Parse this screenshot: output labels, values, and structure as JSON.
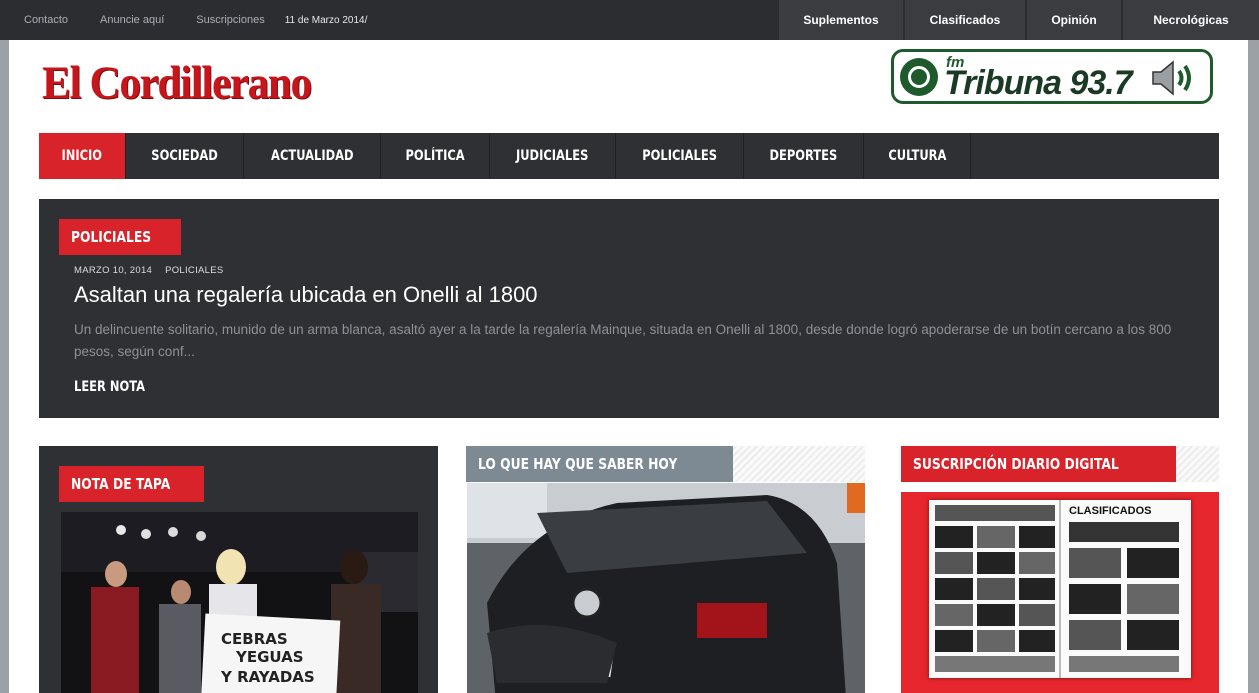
{
  "topbar": {
    "links": [
      "Contacto",
      "Anuncie aquí",
      "Suscripciones"
    ],
    "date": "11 de Marzo 2014/",
    "sections": [
      "Suplementos",
      "Clasificados",
      "Opinión",
      "Necrológicas"
    ]
  },
  "logo": "El Cordillerano",
  "radio": {
    "fm": "fm",
    "name": "Tribuna 93.7"
  },
  "nav": [
    "INICIO",
    "SOCIEDAD",
    "ACTUALIDAD",
    "POLÍTICA",
    "JUDICIALES",
    "POLICIALES",
    "DEPORTES",
    "CULTURA"
  ],
  "featured": {
    "tag": "POLICIALES",
    "date": "MARZO 10, 2014",
    "category": "POLICIALES",
    "headline": "Asaltan una regalería ubicada en Onelli al 1800",
    "excerpt": "Un delincuente solitario, munido de un arma blanca, asaltó ayer a la tarde la regalería Mainque, situada en Onelli al 1800, desde donde logró apoderarse de un botín cercano a los 800 pesos, según conf...",
    "read_more": "LEER NOTA"
  },
  "columns": {
    "nota_de_tapa": {
      "tag": "NOTA DE TAPA",
      "banner_lines": [
        "CEBRAS",
        "YEGUAS",
        "Y RAYADAS"
      ]
    },
    "saber_hoy": {
      "tag": "LO QUE HAY QUE SABER HOY"
    },
    "suscripcion": {
      "tag": "SUSCRIPCIÓN DIARIO DIGITAL",
      "paper_heading": "CLASIFICADOS"
    }
  },
  "colors": {
    "accent": "#d8232a",
    "dark": "#2e3033",
    "radio_green": "#1e5a2c"
  }
}
